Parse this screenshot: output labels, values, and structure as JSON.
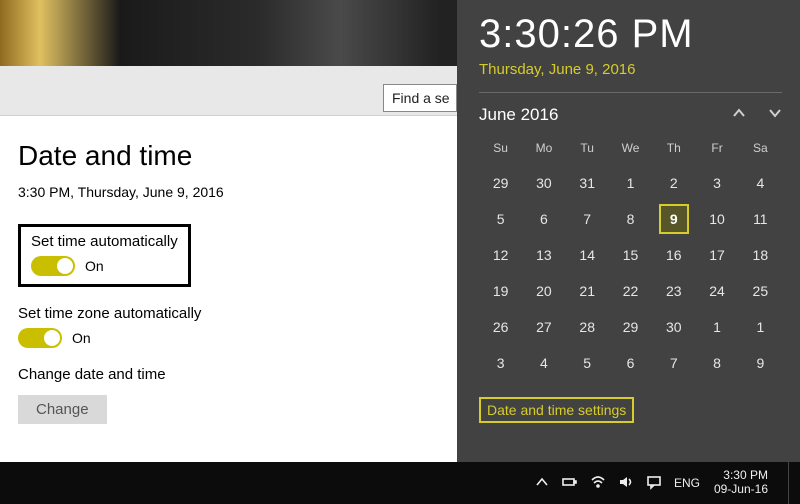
{
  "search": {
    "placeholder": "Find a se"
  },
  "settings": {
    "heading": "Date and time",
    "clock_line": "3:30 PM, Thursday, June 9, 2016",
    "auto_time": {
      "title": "Set time automatically",
      "state": "On"
    },
    "auto_zone": {
      "title": "Set time zone automatically",
      "state": "On"
    },
    "change": {
      "title": "Change date and time",
      "button": "Change"
    }
  },
  "flyout": {
    "time": "3:30:26 PM",
    "date": "Thursday, June 9, 2016",
    "month_label": "June 2016",
    "dow": [
      "Su",
      "Mo",
      "Tu",
      "We",
      "Th",
      "Fr",
      "Sa"
    ],
    "weeks": [
      [
        {
          "d": "29",
          "dim": true
        },
        {
          "d": "30",
          "dim": true
        },
        {
          "d": "31",
          "dim": true
        },
        {
          "d": "1"
        },
        {
          "d": "2"
        },
        {
          "d": "3"
        },
        {
          "d": "4"
        }
      ],
      [
        {
          "d": "5"
        },
        {
          "d": "6"
        },
        {
          "d": "7"
        },
        {
          "d": "8"
        },
        {
          "d": "9",
          "today": true
        },
        {
          "d": "10"
        },
        {
          "d": "11"
        }
      ],
      [
        {
          "d": "12"
        },
        {
          "d": "13"
        },
        {
          "d": "14"
        },
        {
          "d": "15"
        },
        {
          "d": "16"
        },
        {
          "d": "17"
        },
        {
          "d": "18"
        }
      ],
      [
        {
          "d": "19"
        },
        {
          "d": "20"
        },
        {
          "d": "21"
        },
        {
          "d": "22"
        },
        {
          "d": "23"
        },
        {
          "d": "24"
        },
        {
          "d": "25"
        }
      ],
      [
        {
          "d": "26"
        },
        {
          "d": "27"
        },
        {
          "d": "28"
        },
        {
          "d": "29"
        },
        {
          "d": "30"
        },
        {
          "d": "1",
          "dim": true
        },
        {
          "d": "1",
          "dim": true
        }
      ],
      [
        {
          "d": "3",
          "dim": true
        },
        {
          "d": "4",
          "dim": true
        },
        {
          "d": "5",
          "dim": true
        },
        {
          "d": "6",
          "dim": true
        },
        {
          "d": "7",
          "dim": true
        },
        {
          "d": "8",
          "dim": true
        },
        {
          "d": "9",
          "dim": true
        }
      ]
    ],
    "settings_link": "Date and time settings"
  },
  "taskbar": {
    "lang": "ENG",
    "time": "3:30 PM",
    "date": "09-Jun-16"
  }
}
